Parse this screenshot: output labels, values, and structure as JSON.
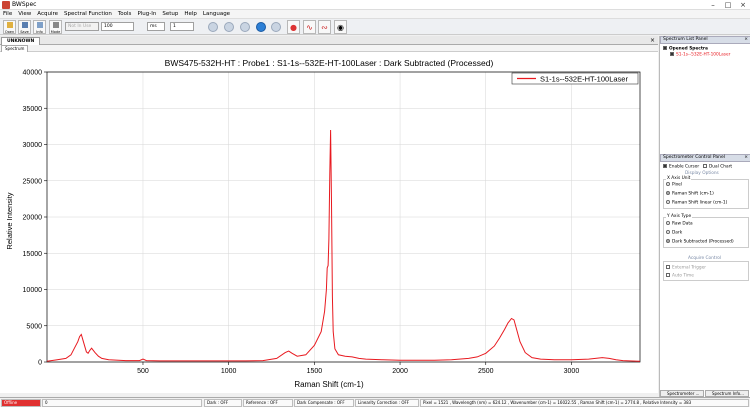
{
  "app": {
    "title": "BWSpec"
  },
  "menu": [
    "File",
    "View",
    "Acquire",
    "Spectral Function",
    "Tools",
    "Plug-In",
    "Setup",
    "Help",
    "Language"
  ],
  "toolbar": {
    "open_label": "Open",
    "save_label": "Save",
    "info_label": "Info",
    "mode_label": "Mode",
    "integration_value": "100",
    "unit_value": "ms",
    "average_value": "1",
    "disabled_field": "Not In Use"
  },
  "tabs": {
    "document": "UNKNOWN",
    "spectrum": "Spectrum"
  },
  "right_panel": {
    "list_title": "Spectrum List Panel",
    "tree_root": "Opened Spectra",
    "tree_child": "S1-1s--532E-HT-100Laser",
    "control_title": "Spectrometer Control Panel",
    "enable_cursor": "Enable Cursor",
    "dual_chart": "Dual Chart",
    "display_options": "Display Options",
    "xaxis_group": "X Axis Unit",
    "x_options": [
      "Pixel",
      "Raman Shift (cm-1)",
      "Raman Shift linear (cm-1)"
    ],
    "yaxis_group": "Y Axis Type",
    "y_options": [
      "Raw Data",
      "Dark",
      "Dark Subtracted (Processed)"
    ],
    "acquire_control": "Acquire Control",
    "ext_trigger": "External Trigger",
    "auto_time": "Auto Time",
    "bottom_tab1": "Spectrometer ...",
    "bottom_tab2": "Spectrum Info..."
  },
  "status": {
    "state": "Offline",
    "value": "0",
    "dark": "Dark : OFF",
    "reference": "Reference : OFF",
    "dark_comp": "Dark Compensate : OFF",
    "linearity": "Linearity Correction : OFF",
    "cursor": "Pixel = 1521 , Wavelength (nm) = 624.12 , Wavenumber (cm-1) = 16022.55 , Raman Shift (cm-1) = 2774.8 , Relative Intensity = 383"
  },
  "colors": {
    "series": "#e8191f",
    "accent": "#1f5fbf"
  },
  "chart_data": {
    "type": "line",
    "title": "BWS475-532H-HT : Probe1 : S1-1s--532E-HT-100Laser : Dark Subtracted (Processed)",
    "xlabel": "Raman Shift (cm-1)",
    "ylabel": "Relative Intensity",
    "xlim": [
      -60,
      3400
    ],
    "ylim": [
      0,
      40000
    ],
    "xticks": [
      500,
      1000,
      1500,
      2000,
      2500,
      3000
    ],
    "yticks": [
      0,
      5000,
      10000,
      15000,
      20000,
      25000,
      30000,
      35000,
      40000
    ],
    "grid": true,
    "legend_position": "top-right",
    "series": [
      {
        "name": "S1-1s--532E-HT-100Laser",
        "x": [
          -60,
          0,
          50,
          80,
          100,
          120,
          130,
          140,
          150,
          170,
          180,
          190,
          200,
          220,
          240,
          260,
          300,
          400,
          480,
          500,
          520,
          600,
          700,
          800,
          900,
          1000,
          1100,
          1200,
          1280,
          1330,
          1350,
          1370,
          1400,
          1450,
          1500,
          1540,
          1560,
          1570,
          1575,
          1580,
          1585,
          1590,
          1595,
          1600,
          1605,
          1610,
          1620,
          1640,
          1680,
          1720,
          1760,
          1800,
          1900,
          2000,
          2100,
          2200,
          2300,
          2400,
          2450,
          2500,
          2550,
          2580,
          2610,
          2630,
          2650,
          2665,
          2680,
          2700,
          2730,
          2770,
          2820,
          2900,
          3000,
          3100,
          3180,
          3220,
          3260,
          3300,
          3400
        ],
        "y": [
          100,
          300,
          500,
          1000,
          1900,
          2800,
          3500,
          3800,
          3000,
          1400,
          1200,
          1600,
          1900,
          1300,
          800,
          500,
          300,
          200,
          200,
          400,
          200,
          150,
          150,
          150,
          150,
          150,
          150,
          200,
          500,
          1300,
          1500,
          1200,
          800,
          1000,
          2300,
          4200,
          7000,
          10000,
          13000,
          13300,
          17000,
          26000,
          32000,
          22000,
          9000,
          4200,
          1800,
          1000,
          800,
          700,
          500,
          400,
          300,
          250,
          250,
          250,
          300,
          500,
          700,
          1200,
          2200,
          3300,
          4500,
          5400,
          6000,
          5800,
          4500,
          2800,
          1300,
          600,
          400,
          300,
          300,
          400,
          600,
          500,
          300,
          200,
          100
        ]
      }
    ]
  }
}
